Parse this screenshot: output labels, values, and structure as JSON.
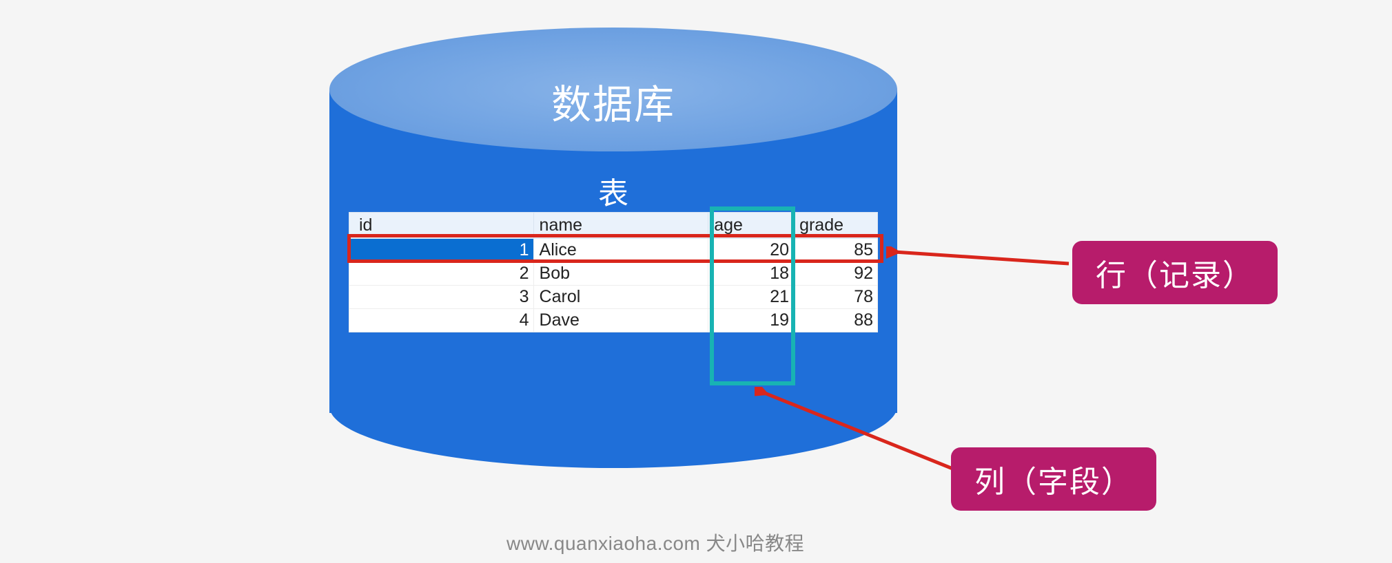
{
  "db_title": "数据库",
  "table_title": "表",
  "columns": {
    "id": "id",
    "name": "name",
    "age": "age",
    "grade": "grade"
  },
  "rows": [
    {
      "id": "1",
      "name": "Alice",
      "age": "20",
      "grade": "85"
    },
    {
      "id": "2",
      "name": "Bob",
      "age": "18",
      "grade": "92"
    },
    {
      "id": "3",
      "name": "Carol",
      "age": "21",
      "grade": "78"
    },
    {
      "id": "4",
      "name": "Dave",
      "age": "19",
      "grade": "88"
    }
  ],
  "labels": {
    "row": "行（记录）",
    "col": "列（字段）"
  },
  "watermark": "www.quanxiaoha.com 犬小哈教程",
  "colors": {
    "cylinder_body": "#1f6fd9",
    "cylinder_top": "#6fa2e2",
    "row_highlight": "#d9261c",
    "col_highlight": "#18b3b3",
    "badge": "#b71c6b",
    "selected_row": "#0a6ed1"
  }
}
